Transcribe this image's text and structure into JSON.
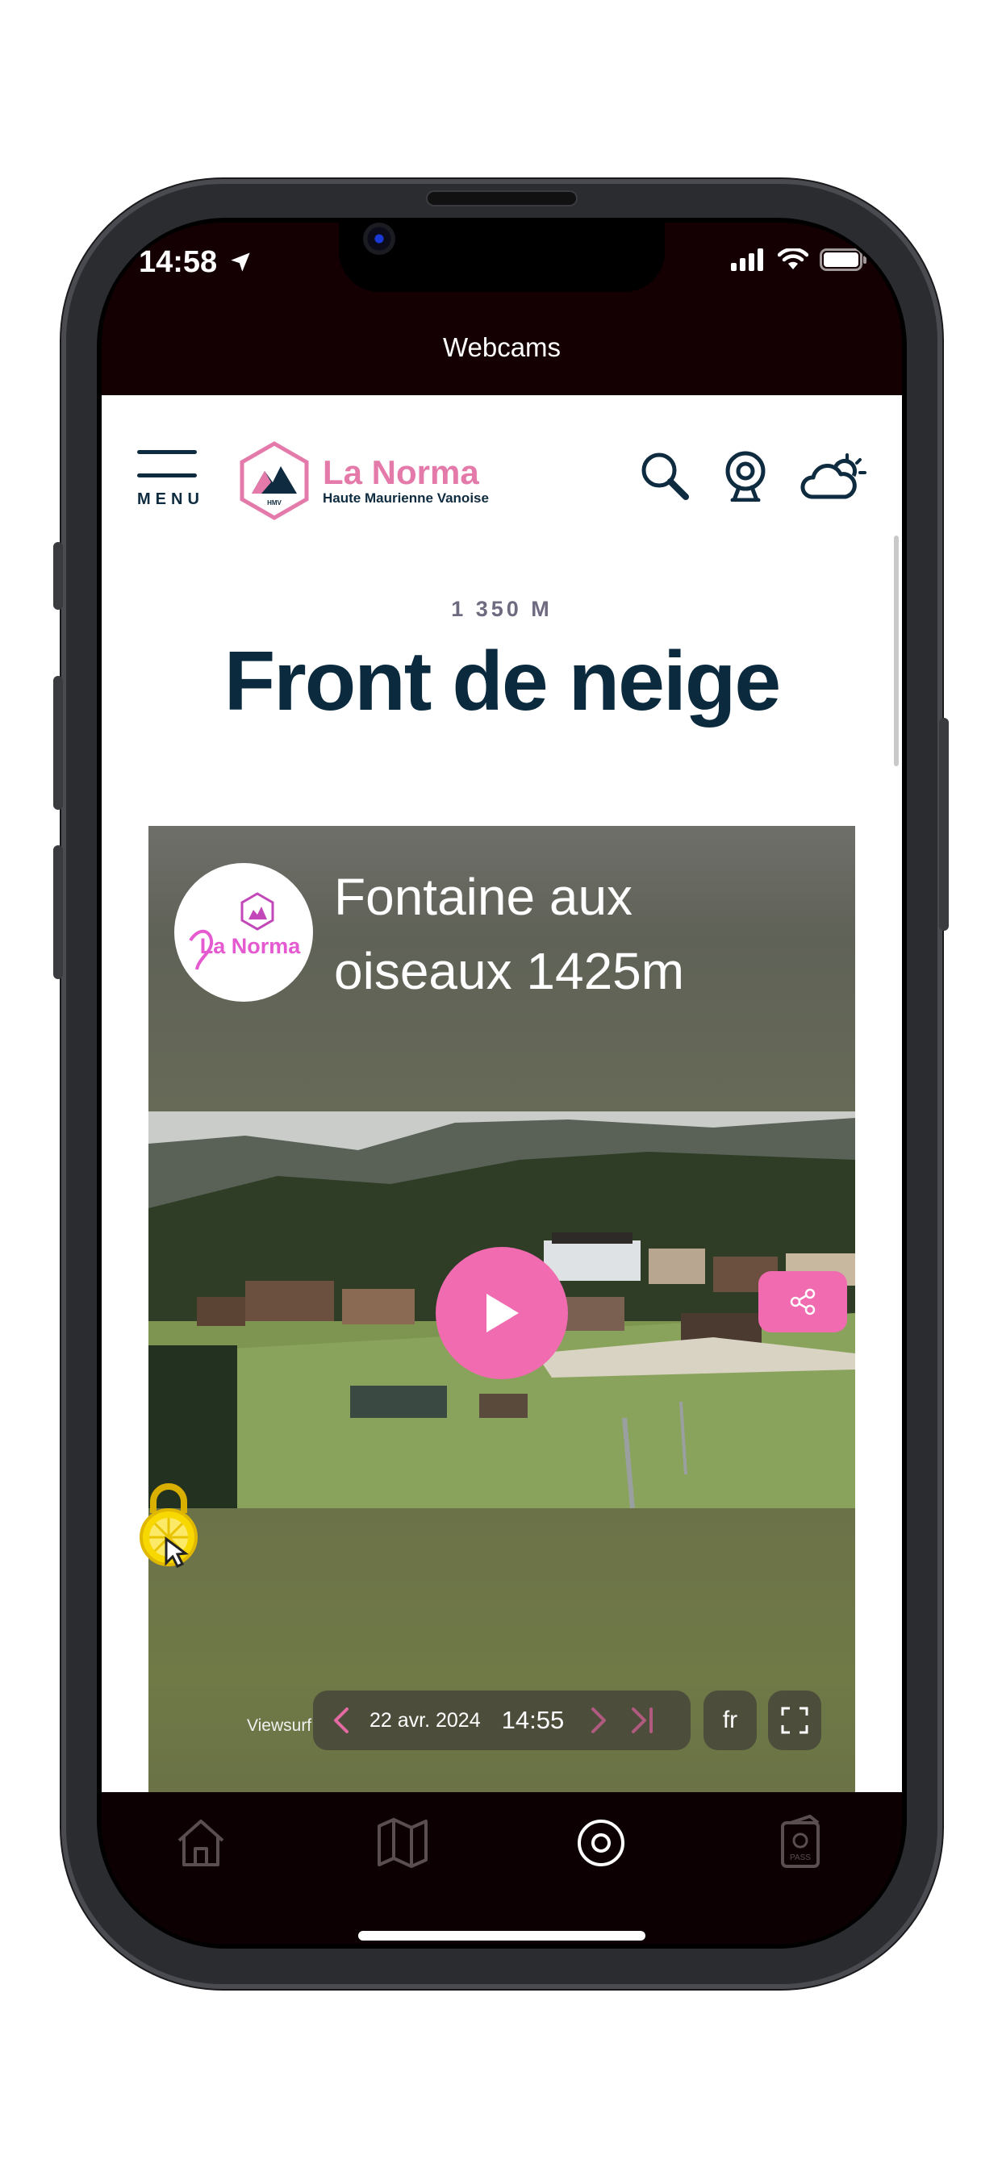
{
  "status_bar": {
    "time": "14:58"
  },
  "app": {
    "title": "Webcams"
  },
  "header": {
    "menu_label": "MENU",
    "logo": {
      "name": "La Norma",
      "subtitle": "Haute Maurienne Vanoise",
      "badge": "HMV"
    }
  },
  "page": {
    "altitude": "1 350 M",
    "title": "Front de neige"
  },
  "webcam": {
    "title": "Fontaine aux oiseaux 1425m",
    "logo_text": "La Norma",
    "provider": "Viewsurf",
    "date": "22 avr. 2024",
    "time": "14:55",
    "language": "fr"
  },
  "tabbar": {
    "items": [
      {
        "icon": "home-icon"
      },
      {
        "icon": "map-icon"
      },
      {
        "icon": "webcam-target-icon",
        "active": true
      },
      {
        "icon": "ski-pass-icon",
        "label": "PASS"
      }
    ]
  },
  "colors": {
    "brand_pink": "#f06bb0",
    "navy": "#0b2a3e",
    "app_bg": "#140002"
  }
}
